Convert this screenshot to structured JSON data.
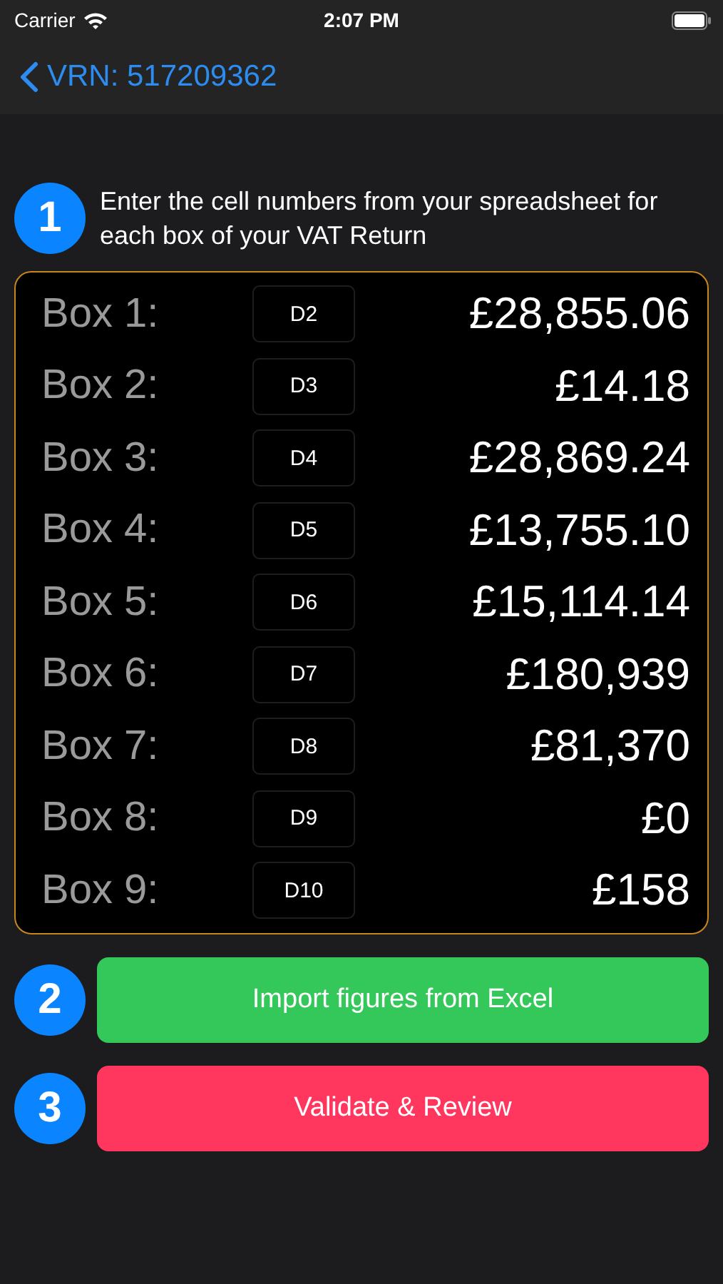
{
  "status_bar": {
    "carrier": "Carrier",
    "time": "2:07 PM"
  },
  "nav": {
    "back_label": "VRN: 517209362"
  },
  "instruction": {
    "step": "1",
    "text": "Enter the cell numbers from your spreadsheet for each box of your VAT Return"
  },
  "boxes": [
    {
      "label": "Box 1:",
      "cell": "D2",
      "amount": "£28,855.06"
    },
    {
      "label": "Box 2:",
      "cell": "D3",
      "amount": "£14.18"
    },
    {
      "label": "Box 3:",
      "cell": "D4",
      "amount": "£28,869.24"
    },
    {
      "label": "Box 4:",
      "cell": "D5",
      "amount": "£13,755.10"
    },
    {
      "label": "Box 5:",
      "cell": "D6",
      "amount": "£15,114.14"
    },
    {
      "label": "Box 6:",
      "cell": "D7",
      "amount": "£180,939"
    },
    {
      "label": "Box 7:",
      "cell": "D8",
      "amount": "£81,370"
    },
    {
      "label": "Box 8:",
      "cell": "D9",
      "amount": "£0"
    },
    {
      "label": "Box 9:",
      "cell": "D10",
      "amount": "£158"
    }
  ],
  "actions": [
    {
      "step": "2",
      "label": "Import figures from Excel",
      "color": "#34c759"
    },
    {
      "step": "3",
      "label": "Validate & Review",
      "color": "#ff375f"
    }
  ]
}
